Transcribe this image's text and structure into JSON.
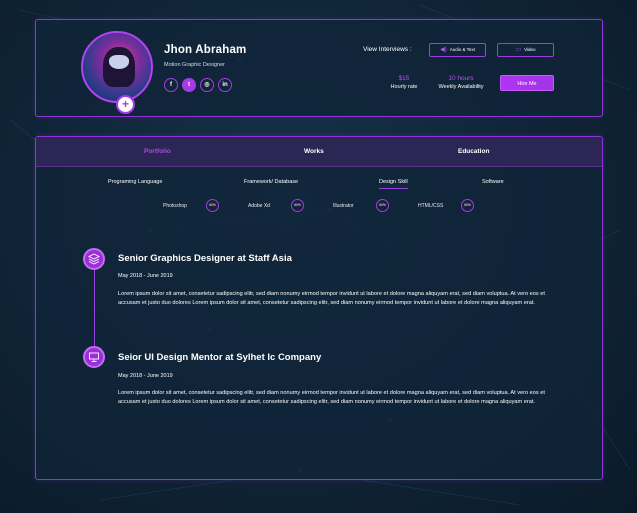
{
  "profile": {
    "name": "Jhon Abraham",
    "role": "Motion Graphic Designer",
    "socials": [
      {
        "icon": "facebook-icon",
        "glyph": "f"
      },
      {
        "icon": "twitter-icon",
        "glyph": "t"
      },
      {
        "icon": "instagram-icon",
        "glyph": "◎"
      },
      {
        "icon": "linkedin-icon",
        "glyph": "in"
      }
    ],
    "view_interviews_label": "View Interviews :",
    "audio_text_label": "Audio & Text",
    "video_label": "Video",
    "hourly_rate_value": "$15",
    "hourly_rate_label": "Hourly rate",
    "availability_value": "10 hours",
    "availability_label": "Weekly Availability",
    "hire_label": "Hire Me",
    "accent": "#a53be6"
  },
  "tabs": [
    "Portfolio",
    "Works",
    "Education"
  ],
  "active_tab": "Portfolio",
  "subtabs": [
    "Programing Language",
    "Framework/ Database",
    "Design Skill",
    "Software"
  ],
  "active_subtab": "Design Skill",
  "skills": [
    {
      "name": "Photoshop",
      "level": "60%"
    },
    {
      "name": "Adobe Xd",
      "level": "60%"
    },
    {
      "name": "Illustrator",
      "level": "60%"
    },
    {
      "name": "HTML/CSS",
      "level": "60%"
    }
  ],
  "timeline": [
    {
      "icon": "layers-icon",
      "title": "Senior Graphics Designer at Staff Asia",
      "date": "May 2018 - June 2019",
      "text": "Lorem ipsum dolor sit amet, consetetur sadipscing elitr, sed diam nonumy eirmod tempor invidunt ut labore et dolore magna aliquyam erat, sed diam voluptua. At vero eos et accusam et justo duo dolores Lorem ipsum dolor sit amet, consetetur sadipscing elitr, sed diam nonumy eirmod tempor invidunt ut labore et dolore magna aliquyam erat."
    },
    {
      "icon": "monitor-icon",
      "title": "Seior UI Design Mentor at Sylhet Ic Company",
      "date": "May 2018 - June 2019",
      "text": "Lorem ipsum dolor sit amet, consetetur sadipscing elitr, sed diam nonumy eirmod tempor invidunt ut labore et dolore magna aliquyam erat, sed diam voluptua. At vero eos et accusam et justo duo dolores Lorem ipsum dolor sit amet, consetetur sadipscing elitr, sed diam nonumy eirmod tempor invidunt ut labore et dolore magna aliquyam erat."
    }
  ]
}
